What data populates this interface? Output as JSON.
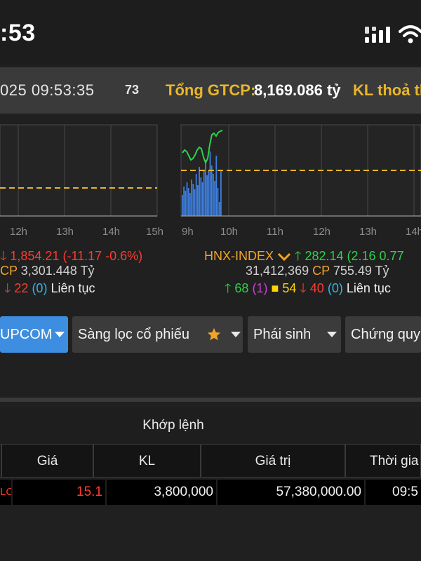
{
  "status_bar": {
    "time": ":53",
    "signal_icon": "cellular-signal-icon",
    "wifi_icon": "wifi-icon"
  },
  "ticker": {
    "datetime": "025 09:53:35",
    "code_fragment": "73",
    "gtcp_label": "Tổng GTCP:",
    "gtcp_value": "8,169.086 tỷ",
    "kl_label": "KL thoả th"
  },
  "chart_data": [
    {
      "type": "line",
      "title": "",
      "x_tick_labels": [
        "12h",
        "13h",
        "14h",
        "15h"
      ],
      "reference_line": "dashed-yellow",
      "series": []
    },
    {
      "type": "line",
      "title": "",
      "x_tick_labels": [
        "9h",
        "10h",
        "11h",
        "12h",
        "13h",
        "14h"
      ],
      "reference_line": "dashed-yellow",
      "series": []
    }
  ],
  "left_index": {
    "change": "1,854.21 (-11.17 -0.6%)",
    "volume_suffix": "CP",
    "value": "3,301.448 Tỷ",
    "declines": "22",
    "ceiling_floor": "(0)",
    "session": "Liên tục"
  },
  "hnx_index": {
    "name": "HNX-INDEX",
    "value": "282.14",
    "change": "(2.16 0.77",
    "volume": "31,412,369",
    "volume_unit": "CP",
    "traded_value": "755.49 Tỷ",
    "advances": "68",
    "ceiling": "(1)",
    "unchanged": "54",
    "declines": "40",
    "floor": "(0)",
    "session": "Liên tục"
  },
  "tabs": [
    {
      "label": "UPCOM"
    },
    {
      "label": "Sàng lọc cổ phiếu"
    },
    {
      "label": "Phái sinh"
    },
    {
      "label": "Chứng quy"
    }
  ],
  "match_table": {
    "title": "Khớp lệnh",
    "columns": [
      "Giá",
      "KL",
      "Giá trị",
      "Thời gia"
    ],
    "rows": [
      {
        "side": "LC",
        "price": "15.1",
        "volume": "3,800,000",
        "value": "57,380,000.00",
        "time": "09:5"
      }
    ]
  },
  "colors": {
    "accent_blue": "#3d8ee0",
    "up": "#2ed14a",
    "down": "#ff3b30",
    "reference": "#e9b62b"
  }
}
